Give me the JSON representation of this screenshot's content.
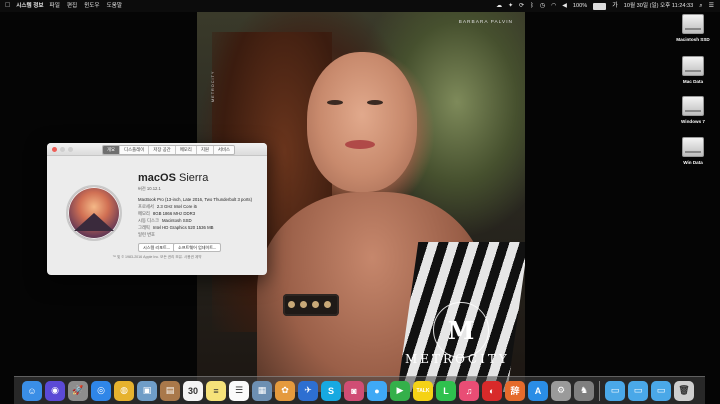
{
  "menubar": {
    "apple_label": "",
    "app_name": "시스템 정보",
    "menus": [
      "파일",
      "편집",
      "윈도우",
      "도움말"
    ],
    "battery_percent": 100,
    "battery_text": "100%",
    "clock": "10월 30일 (일) 오후 11:24:33"
  },
  "wallpaper": {
    "caption": "BARBARA PALVIN",
    "side_text": "METROCITY",
    "logo_letter": "M",
    "brand": "METROCITY",
    "colors": {
      "skin": "#c88a6d",
      "hair": "#6a351d"
    }
  },
  "about_window": {
    "tabs": [
      "개요",
      "디스플레이",
      "저장 공간",
      "메모리",
      "지원",
      "서비스"
    ],
    "active_tab": 0,
    "os_name_bold": "macOS",
    "os_name_light": "Sierra",
    "version": "버전 10.12.1",
    "specs": [
      {
        "key": "",
        "value": "MacBook Pro (13-inch, Late 2016, Two Thunderbolt 3 ports)"
      },
      {
        "key": "프로세서",
        "value": "2.3 GHz Intel Core i5"
      },
      {
        "key": "메모리",
        "value": "8GB 1866 MHz DDR3"
      },
      {
        "key": "시동 디스크",
        "value": "Macintosh SSD"
      },
      {
        "key": "그래픽",
        "value": "Intel HD Graphics 520 1536 MB"
      },
      {
        "key": "일련 번호",
        "value": ""
      }
    ],
    "buttons": {
      "system_report": "시스템 리포트...",
      "software_update": "소프트웨어 업데이트..."
    },
    "footer": "™ 및 © 1983-2016 Apple Inc. 모든 권리 보유. 사용권 계약"
  },
  "desktop": {
    "disks": [
      "Macintosh SSD",
      "Mac Data",
      "Windows 7",
      "Win Data"
    ]
  },
  "dock": {
    "items": [
      {
        "name": "finder",
        "glyph": "☺",
        "color": "#3a8ee6"
      },
      {
        "name": "siri",
        "glyph": "◉",
        "color": "#5b4ad6"
      },
      {
        "name": "launchpad",
        "glyph": "🚀",
        "color": "#8d8d8d"
      },
      {
        "name": "safari",
        "glyph": "◎",
        "color": "#2f86e8"
      },
      {
        "name": "chrome",
        "glyph": "◍",
        "color": "#e6b22e"
      },
      {
        "name": "preview",
        "glyph": "▣",
        "color": "#6f9dc7"
      },
      {
        "name": "address-book",
        "glyph": "▤",
        "color": "#a9784a"
      },
      {
        "name": "calendar",
        "glyph": "30",
        "color": "#f4f4f4"
      },
      {
        "name": "notes",
        "glyph": "≡",
        "color": "#f6e27a"
      },
      {
        "name": "reminders",
        "glyph": "☰",
        "color": "#fafafa"
      },
      {
        "name": "image-capture",
        "glyph": "▦",
        "color": "#6d8fb2"
      },
      {
        "name": "photos",
        "glyph": "✿",
        "color": "#e59a3d"
      },
      {
        "name": "mail",
        "glyph": "✈",
        "color": "#2d6fd1"
      },
      {
        "name": "skype",
        "glyph": "S",
        "color": "#17a9e1"
      },
      {
        "name": "photo-booth",
        "glyph": "◙",
        "color": "#d04d74"
      },
      {
        "name": "messages",
        "glyph": "●",
        "color": "#3fa9f5"
      },
      {
        "name": "facetime",
        "glyph": "▶",
        "color": "#34b04a"
      },
      {
        "name": "kakaotalk",
        "glyph": "TALK",
        "color": "#f5d215"
      },
      {
        "name": "line",
        "glyph": "L",
        "color": "#2fc14e"
      },
      {
        "name": "itunes",
        "glyph": "♫",
        "color": "#e94d75"
      },
      {
        "name": "music-player",
        "glyph": "◐",
        "color": "#d82a2a"
      },
      {
        "name": "dictionary",
        "glyph": "辞",
        "color": "#e56b2c"
      },
      {
        "name": "app-store",
        "glyph": "A",
        "color": "#2a8de6"
      },
      {
        "name": "system-preferences",
        "glyph": "⚙",
        "color": "#9a9a9a"
      },
      {
        "name": "automator",
        "glyph": "♞",
        "color": "#7f7f7f"
      },
      {
        "name": "folder-1",
        "glyph": "▭",
        "color": "#4aa8e8"
      },
      {
        "name": "folder-2",
        "glyph": "▭",
        "color": "#4aa8e8"
      },
      {
        "name": "folder-3",
        "glyph": "▭",
        "color": "#4aa8e8"
      },
      {
        "name": "trash",
        "glyph": "🗑",
        "color": "#cfcfcf"
      }
    ]
  }
}
